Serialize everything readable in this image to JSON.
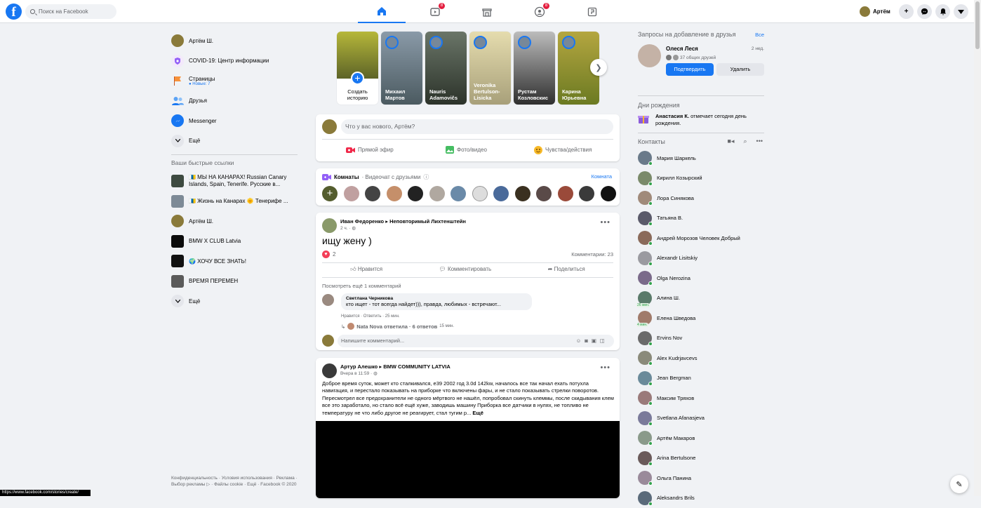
{
  "topbar": {
    "search_placeholder": "Поиск на Facebook",
    "profile_name": "Артём",
    "badges": {
      "watch": "8",
      "groups": "8"
    }
  },
  "left_nav": {
    "items": [
      {
        "label": "Артём Ш.",
        "icon": "avatar"
      },
      {
        "label": "COVID-19: Центр информации",
        "icon": "covid-shield-icon"
      },
      {
        "label": "Страницы",
        "sub": "Новые: 7",
        "icon": "flag-icon"
      },
      {
        "label": "Друзья",
        "icon": "friends-icon"
      },
      {
        "label": "Messenger",
        "icon": "messenger-icon"
      },
      {
        "label": "Ещё",
        "icon": "chevron-down-icon"
      }
    ],
    "shortcuts_title": "Ваши быстрые ссылки",
    "shortcuts": [
      {
        "label": "🇮🇨 МЫ НА КАНАРАХ! Russian Canary Islands, Spain, Tenerife. Русские в..."
      },
      {
        "label": "🇮🇨 Жизнь на Канарах 🌞 Тенерифе ..."
      },
      {
        "label": "Артём Ш."
      },
      {
        "label": "BMW X CLUB Latvia"
      },
      {
        "label": "🌍 ХОЧУ ВСЕ ЗНАТЬ!"
      },
      {
        "label": "ВРЕМЯ ПЕРЕМЕН"
      }
    ],
    "more": "Ещё",
    "footer": "Конфиденциальность · Условия использования · Реклама · Выбор рекламы ▷ · Файлы cookie · Ещё · Facebook © 2020"
  },
  "stories": {
    "create_label": "Создать историю",
    "items": [
      {
        "name": "Михаил Мартов",
        "color": "#6b7a85"
      },
      {
        "name": "Nauris Adamovičs",
        "color": "#3e4a3c"
      },
      {
        "name": "Veronika Bertulson-Lisicka",
        "color": "#c9b98a"
      },
      {
        "name": "Рустам Козловскис",
        "color": "#4b4b4b"
      },
      {
        "name": "Карина Юрьевна",
        "color": "#9a8a2e"
      }
    ]
  },
  "composer": {
    "placeholder": "Что у вас нового, Артём?",
    "live": "Прямой эфир",
    "photo": "Фото/видео",
    "feeling": "Чувства/действия"
  },
  "rooms": {
    "title": "Комнаты",
    "subtitle": "· Видеочат с друзьями",
    "link": "Комната"
  },
  "post1": {
    "author": "Иван Федоренко",
    "group": "Неповторимый Лихтенштейн",
    "time": "2 ч. ·",
    "text": "ищу жену )",
    "reactions": "2",
    "comments_count": "Комментарии: 23",
    "like": "Нравится",
    "comment": "Комментировать",
    "share": "Поделиться",
    "more_comments": "Посмотреть ещё 1 комментарий",
    "comment_author": "Светлана Черникова",
    "comment_text": "кто ищет - тот всегда найдет))), правда, любимых - встречают...",
    "comment_actions": "Нравится · Ответить · 25 мин.",
    "reply_info": "Nata Nova ответила · 6 ответов",
    "reply_time": "15 мин.",
    "write_comment": "Напишите комментарий..."
  },
  "post2": {
    "author": "Артур Алешко",
    "group": "BMW COMMUNITY LATVIA",
    "time": "Вчера в 11:59 ·",
    "text": "Доброе время суток, может кто сталкивался, e39 2002 год 3.0d 142kw, началось все так начал ехать потухла навигация, и перестало показывать на приборке что включены фары, и не стало показывать стрелки поворотов. Пересмотрел все предохранители не одного мёртвого не нашёл, попробовал скинуть клеммы, после скидывания клем все это заработало, но стало всё ещё хуже, заводишь машину Приборка все датчики в нулях, не топливо не температуру не что либо другое не реагирует, стал тугим р...",
    "more": "Ещё"
  },
  "right": {
    "requests_title": "Запросы на добавление в друзья",
    "requests_all": "Все",
    "request_name": "Олеся Леся",
    "request_time": "2 нед.",
    "request_mutual": "37 общих друзей",
    "confirm": "Подтвердить",
    "delete": "Удалить",
    "birthdays_title": "Дни рождения",
    "birthday_name": "Анастасия К.",
    "birthday_text": " отмечает сегодня день рождения.",
    "contacts_title": "Контакты",
    "contacts": [
      {
        "name": "Мария Шаркель",
        "online": true
      },
      {
        "name": "Кирилл Козырский",
        "online": true
      },
      {
        "name": "Лора Синякова",
        "online": true
      },
      {
        "name": "Татьяна В.",
        "online": true
      },
      {
        "name": "Андрей Морозов Человек Добрый",
        "online": true
      },
      {
        "name": "Alexandr Lisitskiy",
        "online": true
      },
      {
        "name": "Olga Nerozina",
        "online": true
      },
      {
        "name": "Алина Ш.",
        "online": false,
        "badge": "26 мин."
      },
      {
        "name": "Елена Шведова",
        "online": false,
        "badge": "4 мин."
      },
      {
        "name": "Ervins Nov",
        "online": true
      },
      {
        "name": "Alex Kudrjavcevs",
        "online": true
      },
      {
        "name": "Jean Bergman",
        "online": true
      },
      {
        "name": "Максим Тряхов",
        "online": true
      },
      {
        "name": "Svetlana Afanasjeva",
        "online": true
      },
      {
        "name": "Артём Макаров",
        "online": true
      },
      {
        "name": "Arina Bertulsone",
        "online": true
      },
      {
        "name": "Ольга Панина",
        "online": true
      },
      {
        "name": "Aleksandrs Brils",
        "online": true
      }
    ]
  },
  "statusbar": "https://www.facebook.com/stories/create/"
}
